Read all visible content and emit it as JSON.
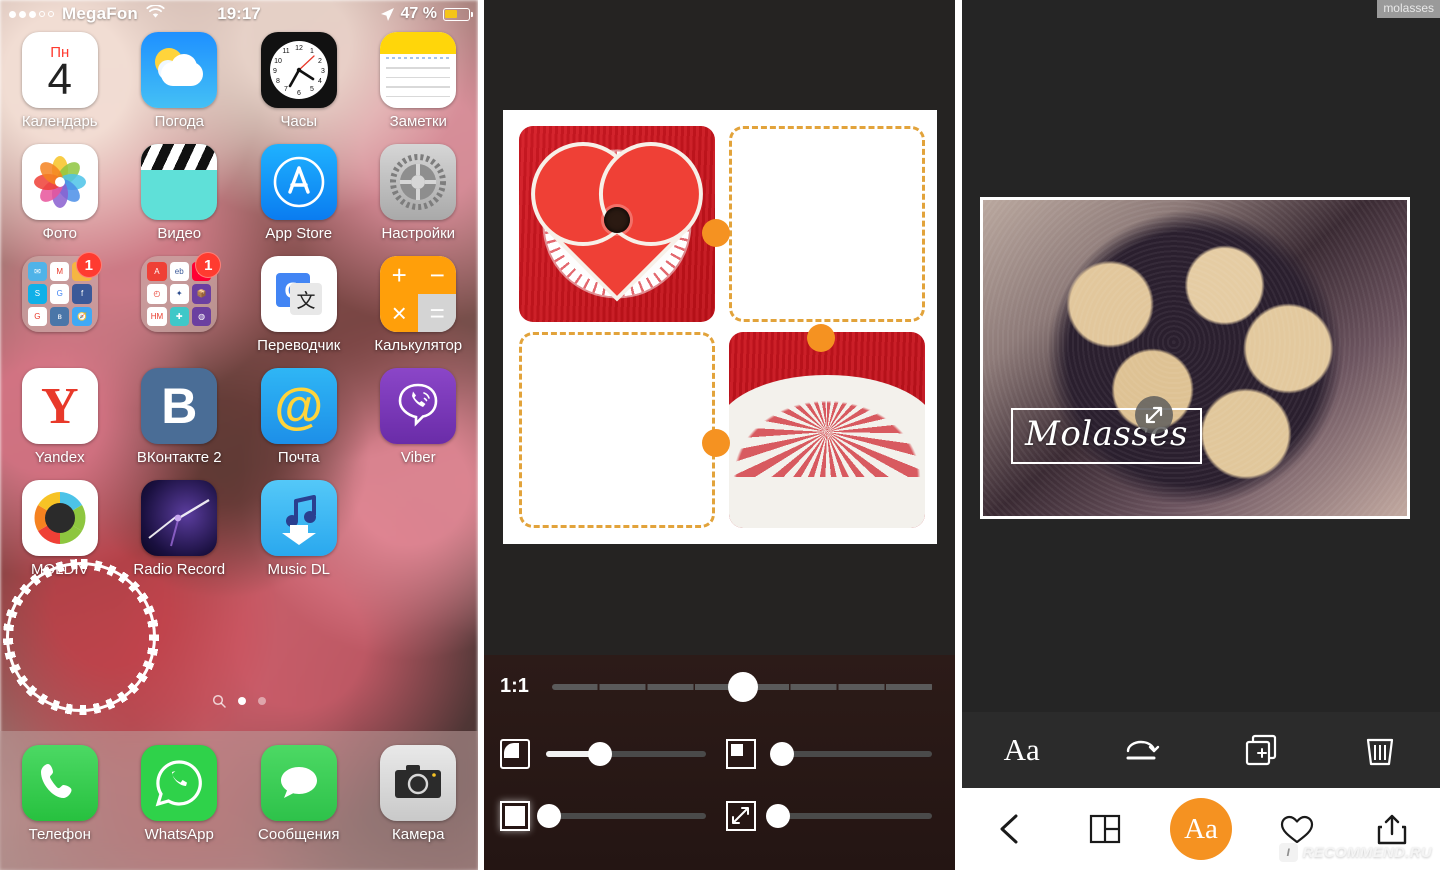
{
  "phone_home": {
    "status_bar": {
      "carrier": "MegaFon",
      "signal_dots_filled": 3,
      "signal_dots_total": 5,
      "wifi_icon": "wifi-icon",
      "time": "19:17",
      "location_icon": "location-arrow-icon",
      "battery_percent": "47 %",
      "battery_level": 47,
      "battery_color": "#f5c518"
    },
    "rows": [
      [
        {
          "label": "Календарь",
          "icon": "calendar-icon",
          "weekday": "Пн",
          "day": "4"
        },
        {
          "label": "Погода",
          "icon": "weather-icon"
        },
        {
          "label": "Часы",
          "icon": "clock-icon"
        },
        {
          "label": "Заметки",
          "icon": "notes-icon"
        }
      ],
      [
        {
          "label": "Фото",
          "icon": "photos-icon"
        },
        {
          "label": "Видео",
          "icon": "videos-icon"
        },
        {
          "label": "App Store",
          "icon": "app-store-icon"
        },
        {
          "label": "Настройки",
          "icon": "settings-icon"
        }
      ],
      [
        {
          "label": "",
          "icon": "folder-icon",
          "badge": "1"
        },
        {
          "label": "",
          "icon": "folder-icon",
          "badge": "1"
        },
        {
          "label": "Переводчик",
          "icon": "google-translate-icon"
        },
        {
          "label": "Калькулятор",
          "icon": "calculator-icon",
          "keys": [
            "+",
            "−",
            "×",
            "="
          ]
        }
      ],
      [
        {
          "label": "Yandex",
          "icon": "yandex-icon",
          "glyph": "Y"
        },
        {
          "label": "ВКонтакте 2",
          "icon": "vk-icon",
          "glyph": "B"
        },
        {
          "label": "Почта",
          "icon": "mail-ru-icon",
          "glyph": "@"
        },
        {
          "label": "Viber",
          "icon": "viber-icon"
        }
      ],
      [
        {
          "label": "MOLDIV",
          "icon": "moldiv-icon",
          "highlighted": true
        },
        {
          "label": "Radio Record",
          "icon": "radio-record-icon"
        },
        {
          "label": "Music DL",
          "icon": "music-dl-icon"
        },
        {
          "label": "",
          "icon": ""
        }
      ]
    ],
    "page_dots": {
      "search_icon": "search-icon",
      "count": 2,
      "active_index": 0
    },
    "dock": [
      {
        "label": "Телефон",
        "icon": "phone-icon"
      },
      {
        "label": "WhatsApp",
        "icon": "whatsapp-icon"
      },
      {
        "label": "Сообщения",
        "icon": "messages-icon"
      },
      {
        "label": "Камера",
        "icon": "camera-icon"
      }
    ]
  },
  "collage_editor": {
    "background_color": "#252322",
    "accent_color": "#f59221",
    "dashed_border_color": "#e2a33b",
    "slots": [
      {
        "position": "top-left",
        "state": "filled",
        "content": "heart-cookie-photo"
      },
      {
        "position": "top-right",
        "state": "empty",
        "content": ""
      },
      {
        "position": "bottom-left",
        "state": "empty",
        "content": ""
      },
      {
        "position": "bottom-right",
        "state": "filled",
        "content": "lace-doily-photo"
      }
    ],
    "handles": 3,
    "controls": {
      "ratio_label": "1:1",
      "ratio_value": 50,
      "ratio_ticks": 8,
      "sliders": [
        {
          "icon": "corner-radius-icon",
          "value": 34
        },
        {
          "icon": "inner-border-icon",
          "value": 6
        },
        {
          "icon": "outer-border-icon",
          "value": 2
        },
        {
          "icon": "scale-icon",
          "value": 4
        }
      ]
    }
  },
  "photo_editor": {
    "background_color": "#252525",
    "accent_color": "#f59221",
    "photo": "cookies-on-plate-photo",
    "text_overlay": {
      "value": "Molasses",
      "style": "handwritten",
      "border": "white-rectangle"
    },
    "resize_handle_icon": "resize-diagonal-icon",
    "edit_toolbar": [
      {
        "icon": "text-style-icon",
        "label": "Aa"
      },
      {
        "icon": "flip-rotate-icon",
        "label": ""
      },
      {
        "icon": "duplicate-icon",
        "label": ""
      },
      {
        "icon": "trash-icon",
        "label": ""
      }
    ],
    "bottom_toolbar": [
      {
        "icon": "back-chevron-icon",
        "label": ""
      },
      {
        "icon": "layout-grid-icon",
        "label": ""
      },
      {
        "icon": "text-tool-icon",
        "label": "Aa",
        "active": true
      },
      {
        "icon": "heart-icon",
        "label": ""
      },
      {
        "icon": "share-icon",
        "label": ""
      }
    ]
  },
  "watermarks": {
    "top_right": "molasses",
    "bottom_right_logo": "I",
    "bottom_right": "RECOMMEND.RU"
  }
}
